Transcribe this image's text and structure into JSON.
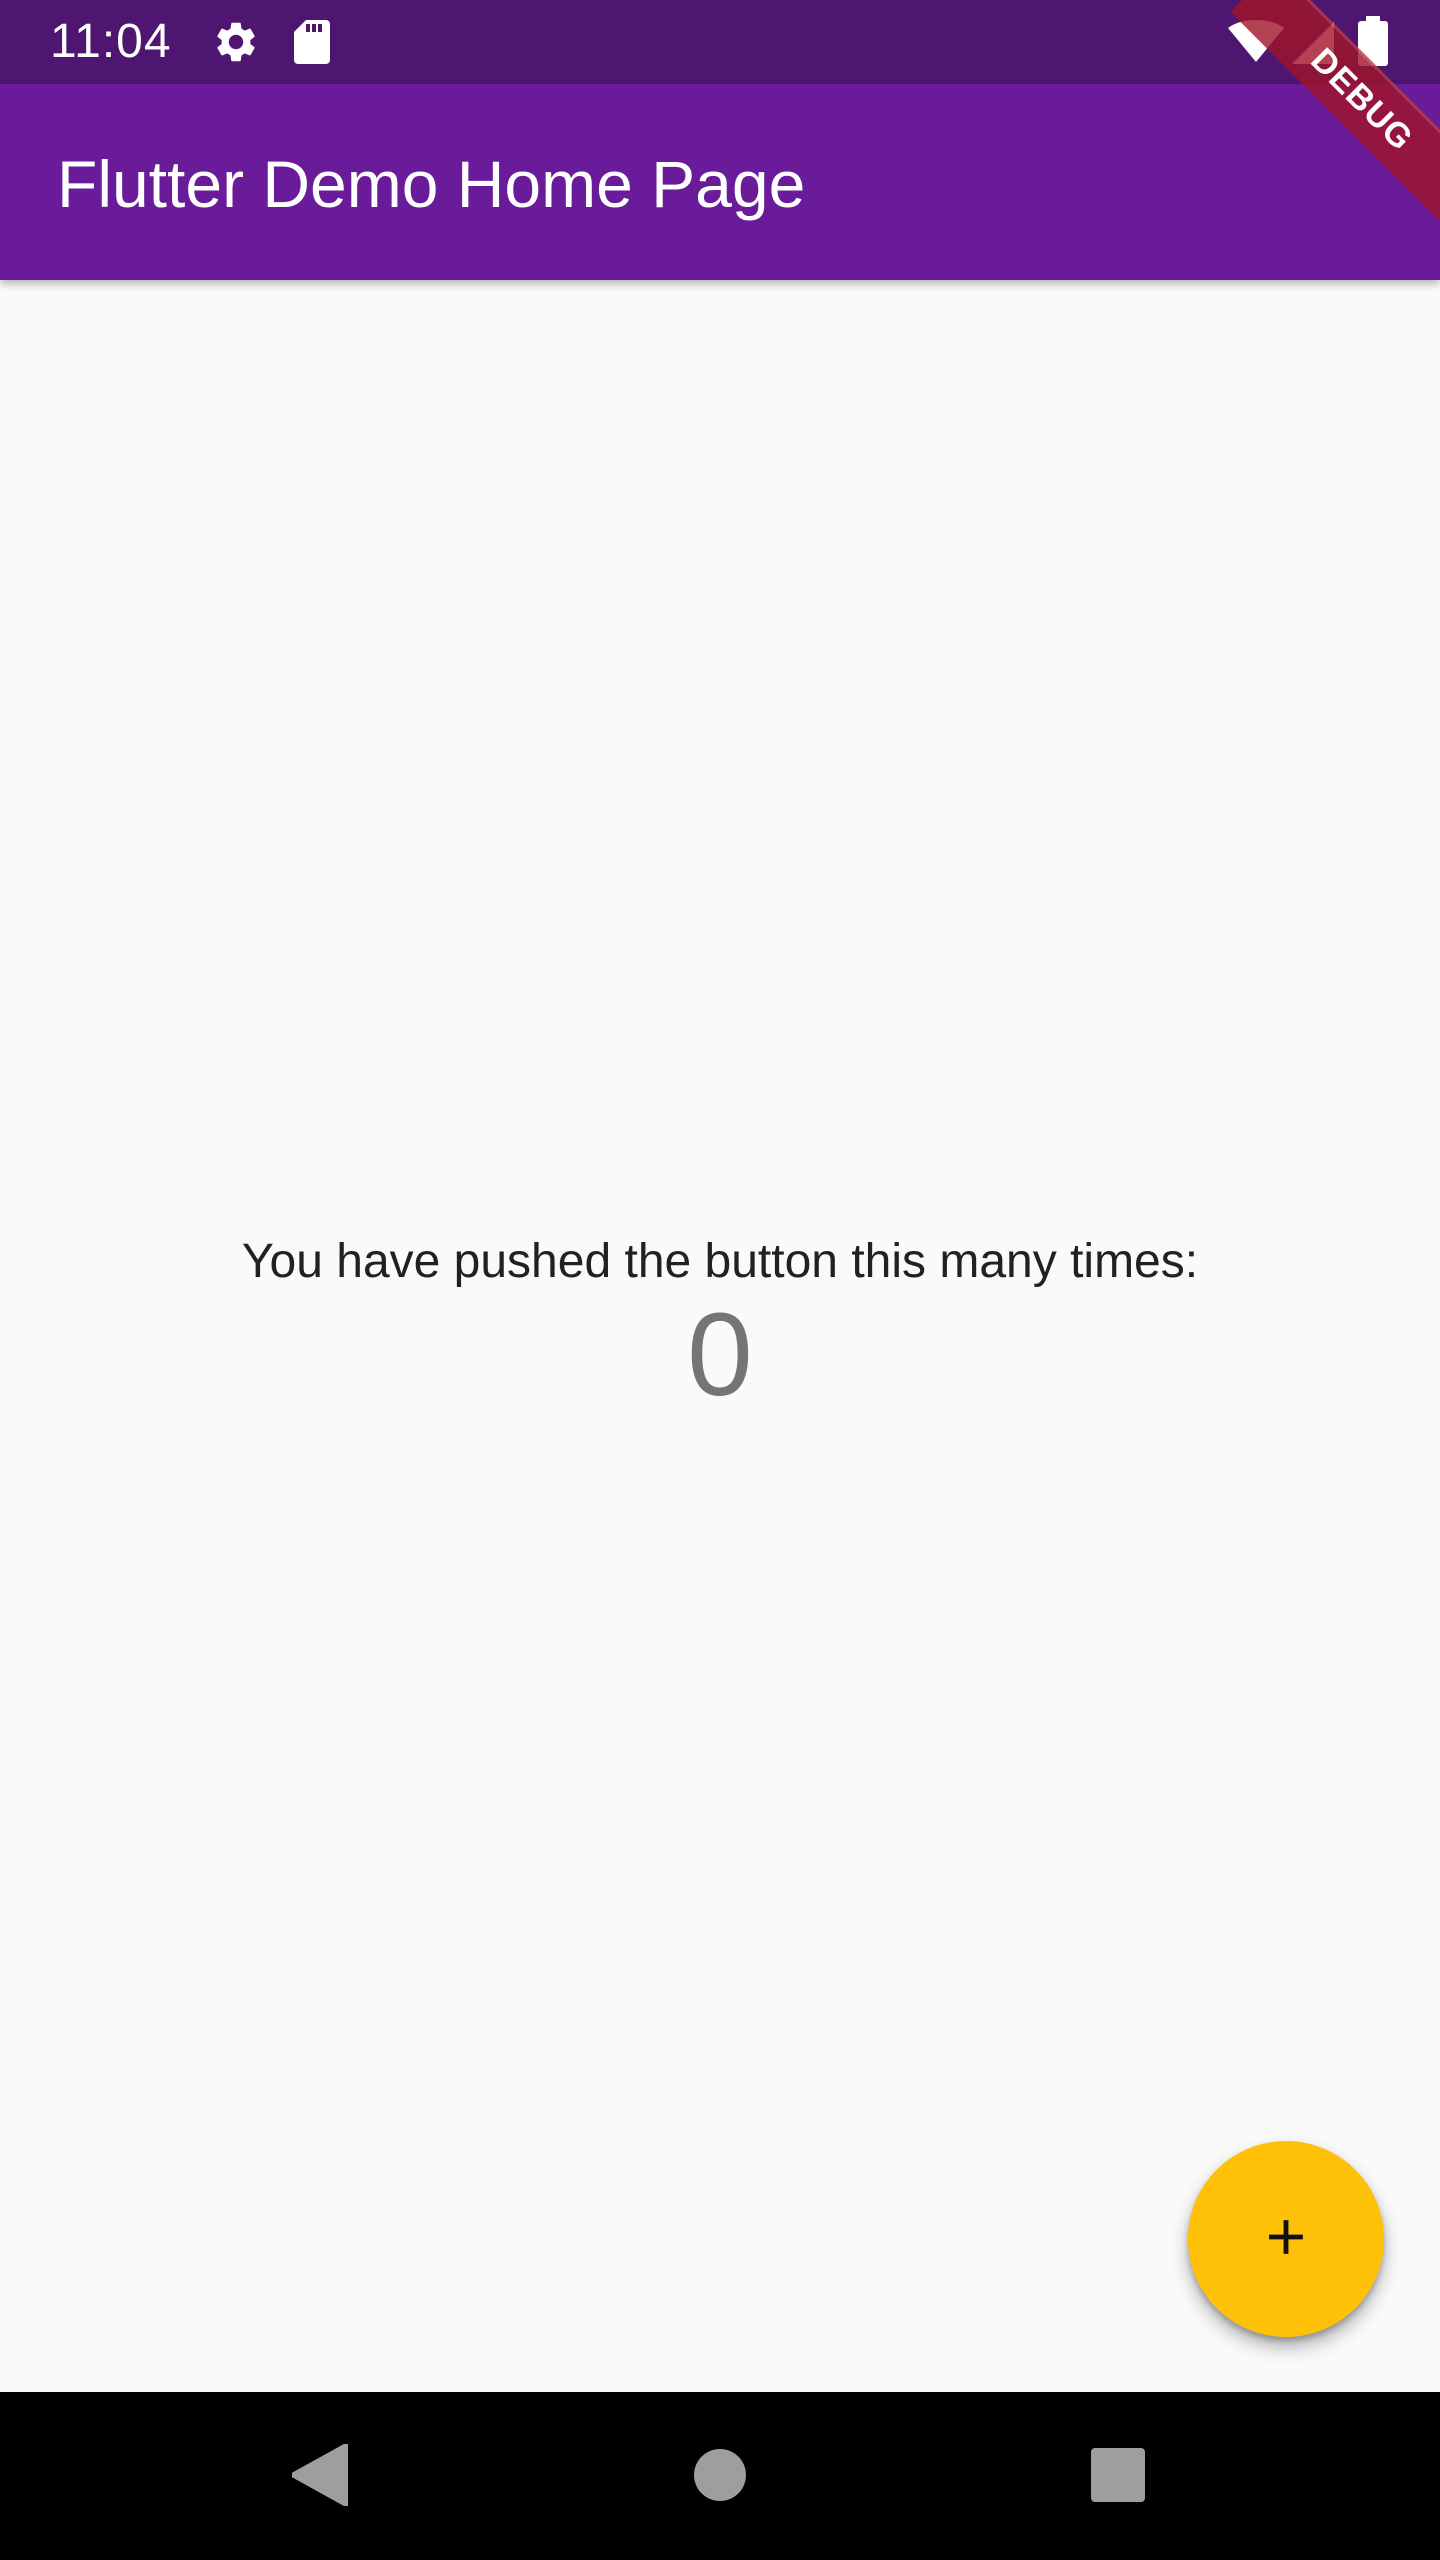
{
  "status_bar": {
    "time": "11:04",
    "icons_left": [
      "gear-icon",
      "sd-card-icon"
    ],
    "icons_right": [
      "wifi-icon",
      "cell-signal-icon",
      "battery-icon"
    ],
    "color": "#4e1571"
  },
  "app_bar": {
    "title": "Flutter Demo Home Page",
    "color": "#6a1b9a"
  },
  "debug_banner": {
    "label": "DEBUG"
  },
  "body": {
    "counter_label": "You have pushed the button this many times:",
    "counter_value": "0"
  },
  "fab": {
    "icon": "plus-icon",
    "color": "#ffc107"
  },
  "nav_bar": {
    "buttons": [
      "back-icon",
      "home-icon",
      "recents-icon"
    ]
  }
}
